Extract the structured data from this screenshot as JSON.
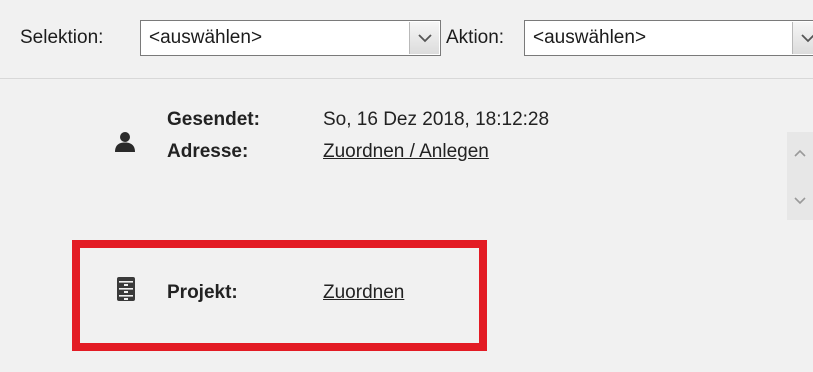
{
  "toolbar": {
    "selektion_label": "Selektion:",
    "selektion_value": "<auswählen>",
    "aktion_label": "Aktion:",
    "aktion_value": "<auswählen>"
  },
  "contact": {
    "icon": "person-icon",
    "sent_label": "Gesendet:",
    "sent_value": "So, 16 Dez 2018, 18:12:28",
    "address_label": "Adresse:",
    "address_link": "Zuordnen / Anlegen"
  },
  "project": {
    "icon": "project-cabinet-icon",
    "label": "Projekt:",
    "link": "Zuordnen",
    "highlight_color": "#e31b24"
  }
}
